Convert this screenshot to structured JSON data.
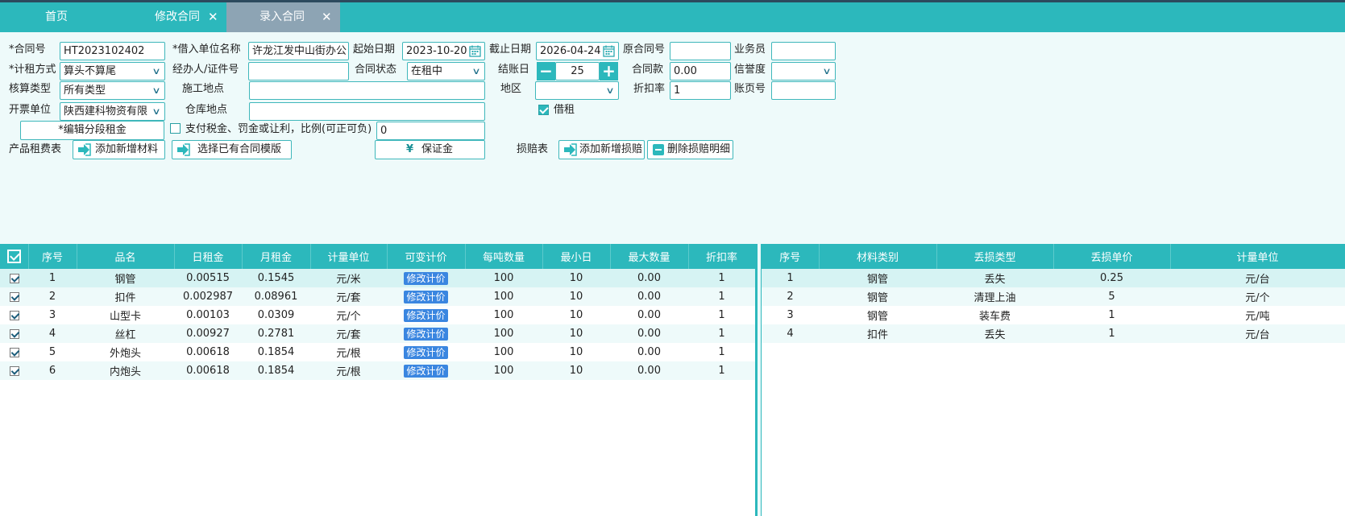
{
  "tabs": [
    {
      "label": "首页"
    },
    {
      "label": "修改合同",
      "close": "✕"
    },
    {
      "label": "录入合同",
      "close": "✕"
    }
  ],
  "form": {
    "contract_no_label": "*合同号",
    "contract_no": "HT2023102402",
    "borrower_label": "*借入单位名称",
    "borrower": "许龙江发中山街办公",
    "start_label": "起始日期",
    "start_date": "2023-10-20",
    "end_label": "截止日期",
    "end_date": "2026-04-24",
    "orig_no_label": "原合同号",
    "orig_no": "",
    "salesman_label": "业务员",
    "salesman": "",
    "rent_method_label": "*计租方式",
    "rent_method": "算头不算尾",
    "agent_label": "经办人/证件号",
    "agent": "",
    "status_label": "合同状态",
    "status": "在租中",
    "billing_day_label": "结账日",
    "billing_day": "25",
    "amount_label": "合同款",
    "amount": "0.00",
    "credit_label": "信誉度",
    "credit": "",
    "calc_type_label": "核算类型",
    "calc_type": "所有类型",
    "site_label": "施工地点",
    "site": "",
    "region_label": "地区",
    "region": "",
    "discount_label": "折扣率",
    "discount": "1",
    "page_no_label": "账页号",
    "page_no": "",
    "invoice_label": "开票单位",
    "invoice": "陕西建科物资有限",
    "warehouse_label": "仓库地点",
    "warehouse": "",
    "borrow_rent_label": "借租",
    "segment_btn": "*编辑分段租金",
    "tax_label": "支付税金、罚金或让利，比例(可正可负)",
    "tax_value": "0",
    "rent_table_label": "产品租费表",
    "add_material_btn": "添加新增材料",
    "select_template_btn": "选择已有合同模版",
    "deposit_btn": "保证金",
    "damage_table_label": "损赔表",
    "add_damage_btn": "添加新增损赔",
    "delete_damage_btn": "删除损赔明细"
  },
  "rent_table": {
    "headers": [
      "序号",
      "品名",
      "日租金",
      "月租金",
      "计量单位",
      "可变计价",
      "每吨数量",
      "最小日",
      "最大数量",
      "折扣率"
    ],
    "tag_label": "修改计价",
    "rows": [
      {
        "no": "1",
        "name": "钢管",
        "day": "0.00515",
        "month": "0.1545",
        "unit": "元/米",
        "per_ton": "100",
        "min_day": "10",
        "max_qty": "0.00",
        "discount": "1"
      },
      {
        "no": "2",
        "name": "扣件",
        "day": "0.002987",
        "month": "0.08961",
        "unit": "元/套",
        "per_ton": "100",
        "min_day": "10",
        "max_qty": "0.00",
        "discount": "1"
      },
      {
        "no": "3",
        "name": "山型卡",
        "day": "0.00103",
        "month": "0.0309",
        "unit": "元/个",
        "per_ton": "100",
        "min_day": "10",
        "max_qty": "0.00",
        "discount": "1"
      },
      {
        "no": "4",
        "name": "丝杠",
        "day": "0.00927",
        "month": "0.2781",
        "unit": "元/套",
        "per_ton": "100",
        "min_day": "10",
        "max_qty": "0.00",
        "discount": "1"
      },
      {
        "no": "5",
        "name": "外炮头",
        "day": "0.00618",
        "month": "0.1854",
        "unit": "元/根",
        "per_ton": "100",
        "min_day": "10",
        "max_qty": "0.00",
        "discount": "1"
      },
      {
        "no": "6",
        "name": "内炮头",
        "day": "0.00618",
        "month": "0.1854",
        "unit": "元/根",
        "per_ton": "100",
        "min_day": "10",
        "max_qty": "0.00",
        "discount": "1"
      }
    ]
  },
  "damage_table": {
    "headers": [
      "序号",
      "材料类别",
      "丢损类型",
      "丢损单价",
      "计量单位"
    ],
    "rows": [
      {
        "no": "1",
        "category": "钢管",
        "type": "丢失",
        "price": "0.25",
        "unit": "元/台"
      },
      {
        "no": "2",
        "category": "钢管",
        "type": "清理上油",
        "price": "5",
        "unit": "元/个"
      },
      {
        "no": "3",
        "category": "钢管",
        "type": "装车费",
        "price": "1",
        "unit": "元/吨"
      },
      {
        "no": "4",
        "category": "扣件",
        "type": "丢失",
        "price": "1",
        "unit": "元/台"
      }
    ]
  },
  "colors": {
    "accent": "#2cb8bc",
    "active_tab": "#8da4b4",
    "tag": "#3a86e0",
    "background": "#eefafa"
  }
}
